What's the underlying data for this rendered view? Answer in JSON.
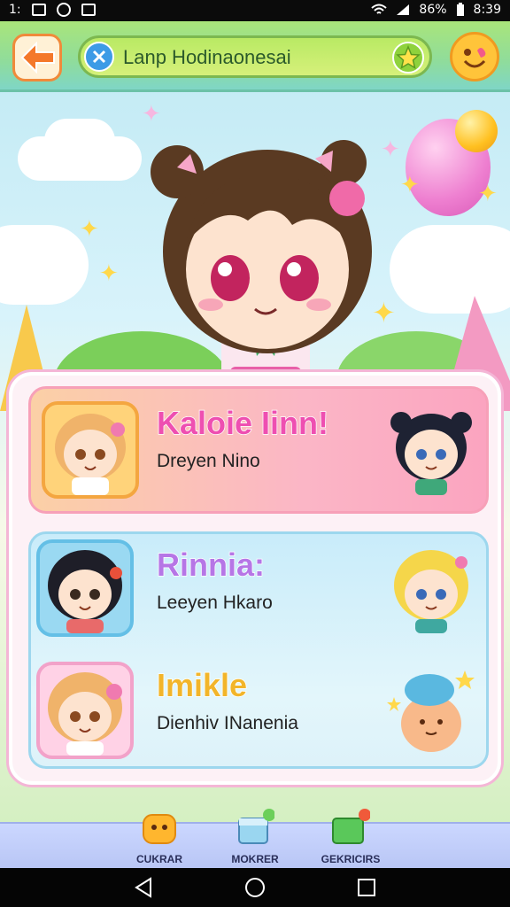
{
  "status_bar": {
    "time_left": "1:",
    "battery_percent": "86%",
    "clock": "8:39"
  },
  "header": {
    "search_text": "Lanp Hodinaonesai"
  },
  "cards": [
    {
      "title": "Kaloie Iinn!",
      "subtitle": "Dreyen Nino",
      "title_color": "#ee4fb1"
    },
    {
      "title": "Rinnia:",
      "subtitle": "Leeyen Hkaro",
      "title_color": "#b676e6"
    },
    {
      "title": "Imikle",
      "subtitle": "Dienhiv INanenia",
      "title_color": "#f2b52a"
    }
  ],
  "bottom_nav": [
    {
      "label": "CUKRAR",
      "icon": "yellow-creature-icon"
    },
    {
      "label": "MOKRER",
      "icon": "gift-box-icon"
    },
    {
      "label": "GEKRICIRS",
      "icon": "green-block-icon"
    }
  ],
  "colors": {
    "accent_pink": "#ee4fb1",
    "accent_green": "#8fdc9c",
    "accent_orange": "#f08a3a"
  }
}
